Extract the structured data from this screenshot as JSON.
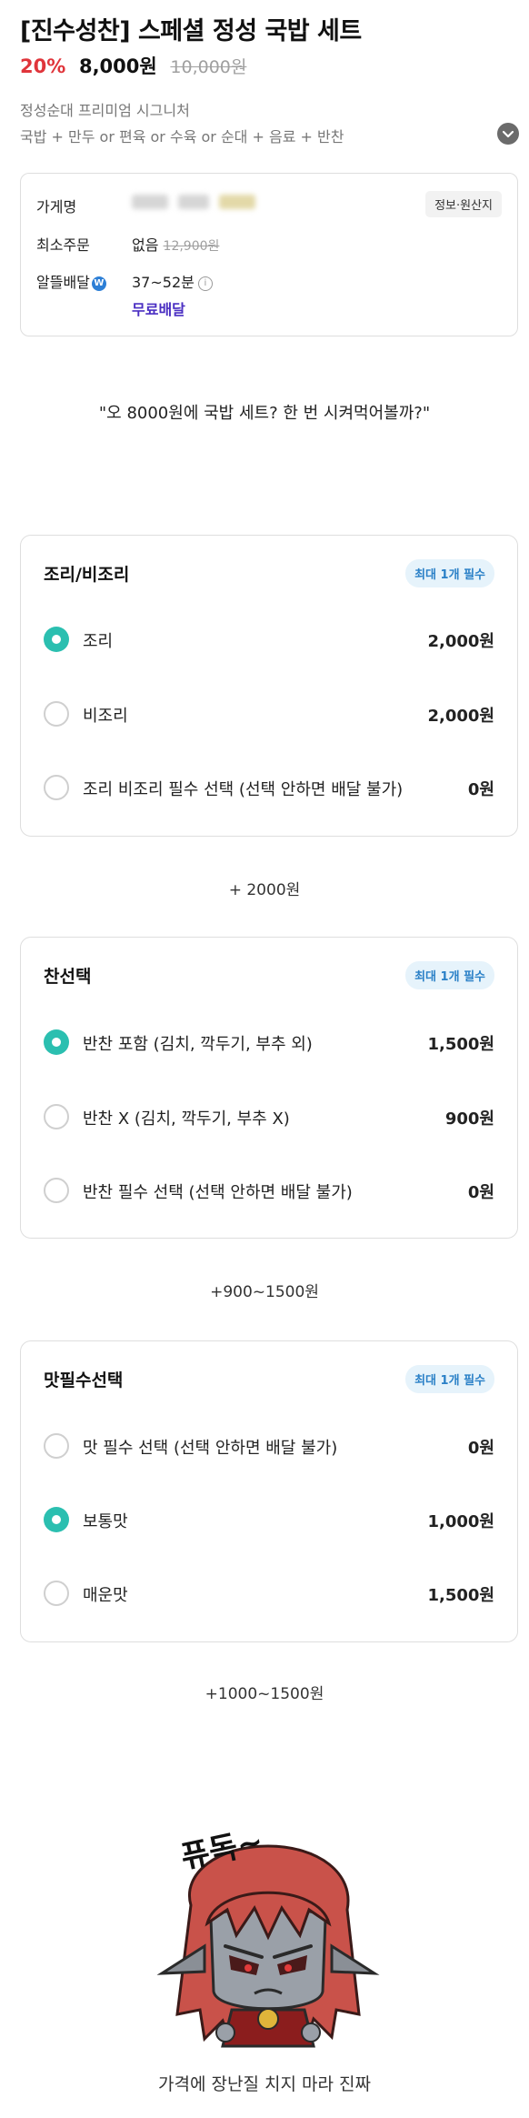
{
  "product": {
    "title": "[진수성찬] 스페셜 정성 국밥 세트",
    "discount": "20%",
    "price": "8,000원",
    "original_price": "10,000원",
    "tagline": "정성순대 프리미엄 시그니처",
    "components": "국밥 + 만두 or 편육 or 수육 or 순대 + 음료 + 반찬"
  },
  "store": {
    "name_label": "가게명",
    "info_badge": "정보·원산지",
    "min_order_label": "최소주문",
    "min_order_value": "없음",
    "min_order_strike": "12,900원",
    "delivery_label": "알뜰배달",
    "delivery_time": "37~52분",
    "free_delivery": "무료배달"
  },
  "quote": "\"오 8000원에 국밥 세트? 한 번 시켜먹어볼까?\"",
  "option_groups": [
    {
      "title": "조리/비조리",
      "badge": "최대 1개 필수",
      "options": [
        {
          "label": "조리",
          "price": "2,000원",
          "selected": true
        },
        {
          "label": "비조리",
          "price": "2,000원",
          "selected": false
        },
        {
          "label": "조리 비조리 필수 선택 (선택 안하면 배달 불가)",
          "price": "0원",
          "selected": false
        }
      ],
      "note": "+ 2000원"
    },
    {
      "title": "찬선택",
      "badge": "최대 1개 필수",
      "options": [
        {
          "label": "반찬 포함 (김치, 깍두기, 부추 외)",
          "price": "1,500원",
          "selected": true
        },
        {
          "label": "반찬 X (김치, 깍두기, 부추 X)",
          "price": "900원",
          "selected": false
        },
        {
          "label": "반찬 필수 선택 (선택 안하면 배달 불가)",
          "price": "0원",
          "selected": false
        }
      ],
      "note": "+900~1500원"
    },
    {
      "title": "맛필수선택",
      "badge": "최대 1개 필수",
      "options": [
        {
          "label": "맛 필수 선택 (선택 안하면 배달 불가)",
          "price": "0원",
          "selected": false
        },
        {
          "label": "보통맛",
          "price": "1,000원",
          "selected": true
        },
        {
          "label": "매운맛",
          "price": "1,500원",
          "selected": false
        }
      ],
      "note": "+1000~1500원"
    }
  ],
  "meme": {
    "speech": "퓨독~",
    "caption": "가격에 장난질 치지 마라 진짜"
  },
  "colors": {
    "accent_red": "#e0353b",
    "radio_teal": "#2bbfb0",
    "free_purple": "#4a2ec2",
    "badge_blue": "#2a80c7"
  }
}
